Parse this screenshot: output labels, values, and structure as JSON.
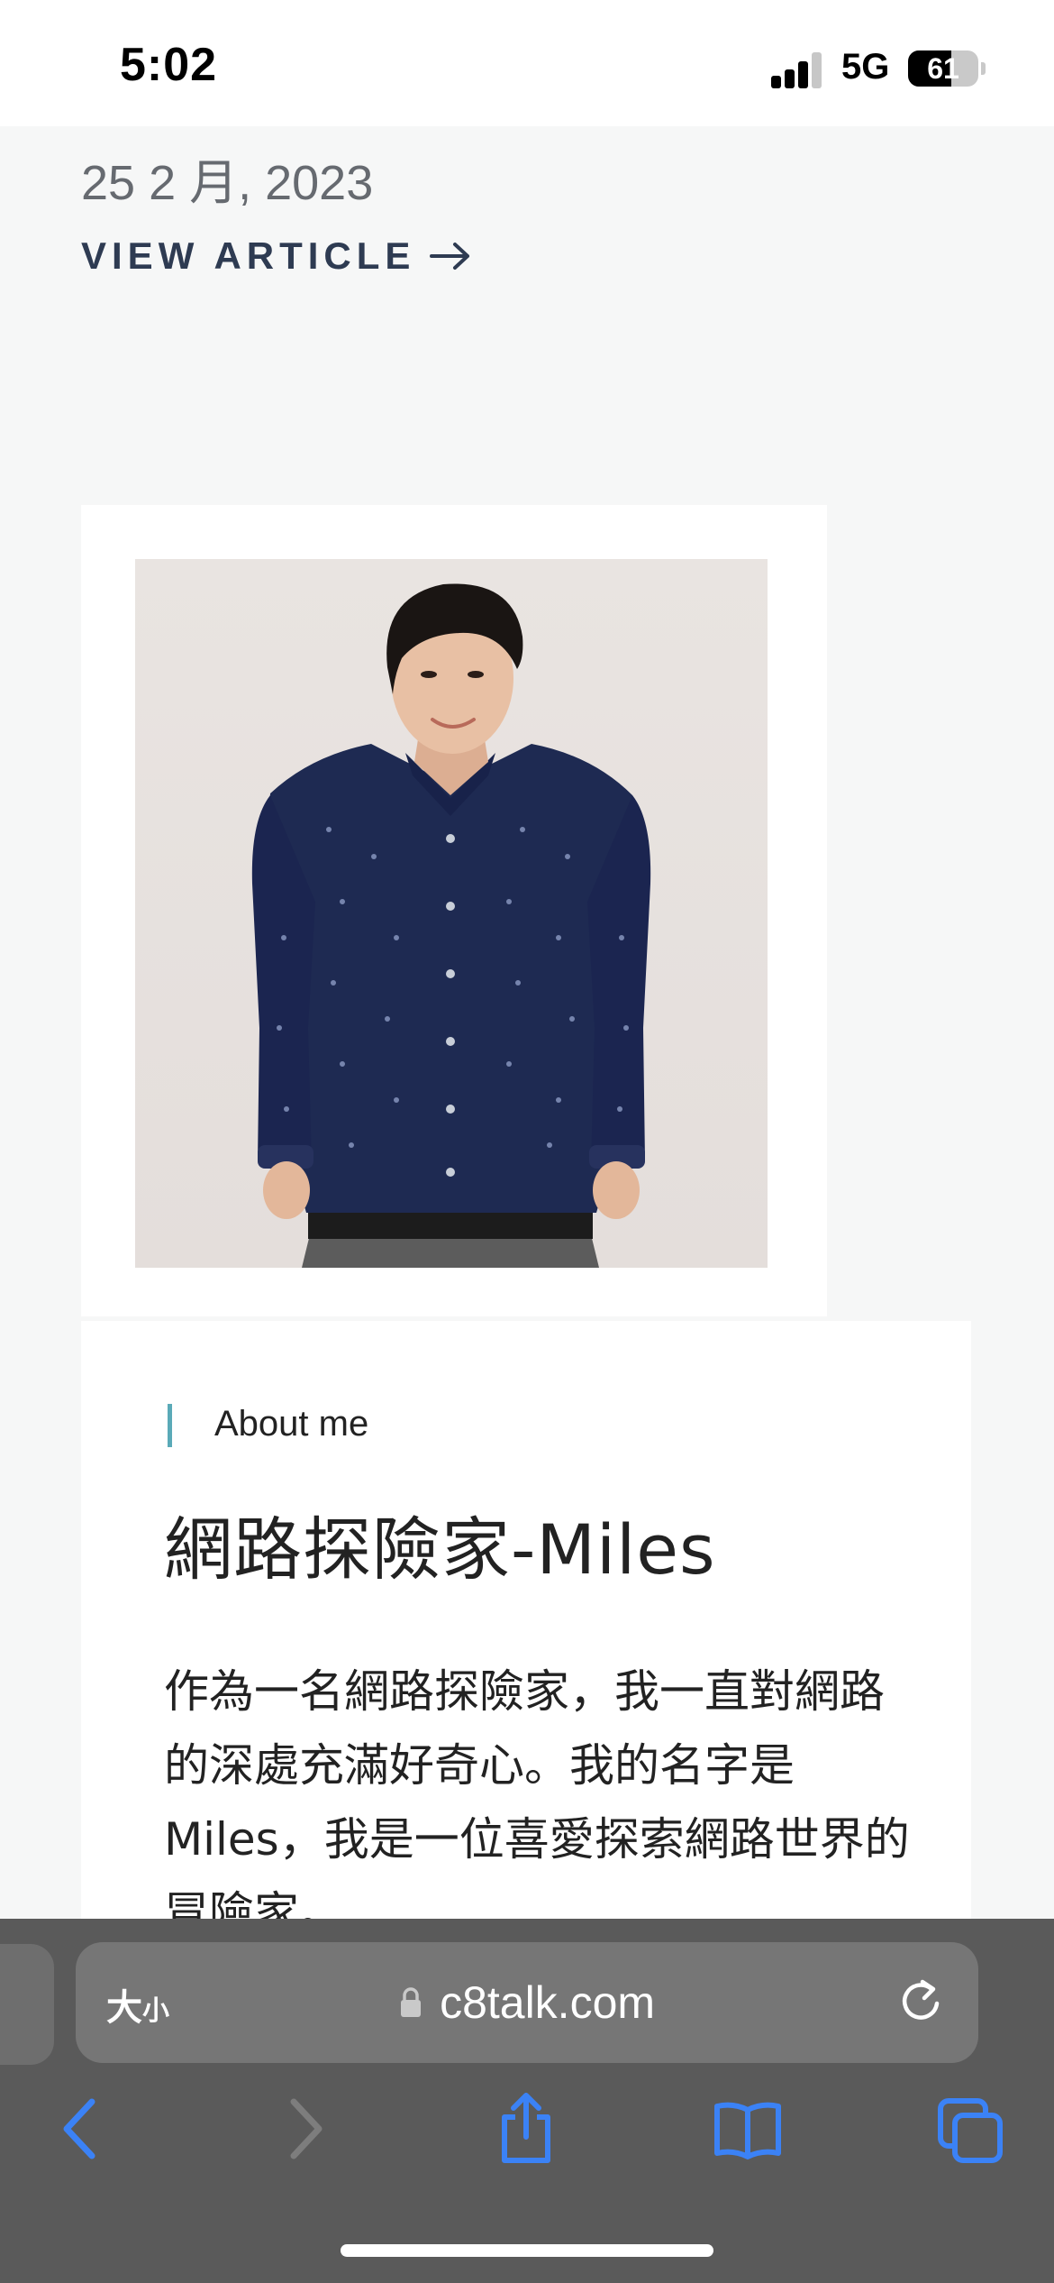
{
  "status_bar": {
    "time": "5:02",
    "network": "5G",
    "battery_level": "61"
  },
  "article": {
    "date": "25 2 月, 2023",
    "view_article_label": "VIEW ARTICLE"
  },
  "profile": {
    "section_label": "About me",
    "name": "網路探險家-Miles",
    "bio": "作為一名網路探險家，我一直對網路的深處充滿好奇心。我的名字是Miles，我是一位喜愛探索網路世界的冒險家。"
  },
  "browser": {
    "text_size_label_large": "大",
    "text_size_label_small": "小",
    "url": "c8talk.com"
  },
  "colors": {
    "accent_bar": "#5aaab8",
    "toolbar_icon_active": "#3b82f6",
    "toolbar_icon_disabled": "#7d7d7d"
  }
}
